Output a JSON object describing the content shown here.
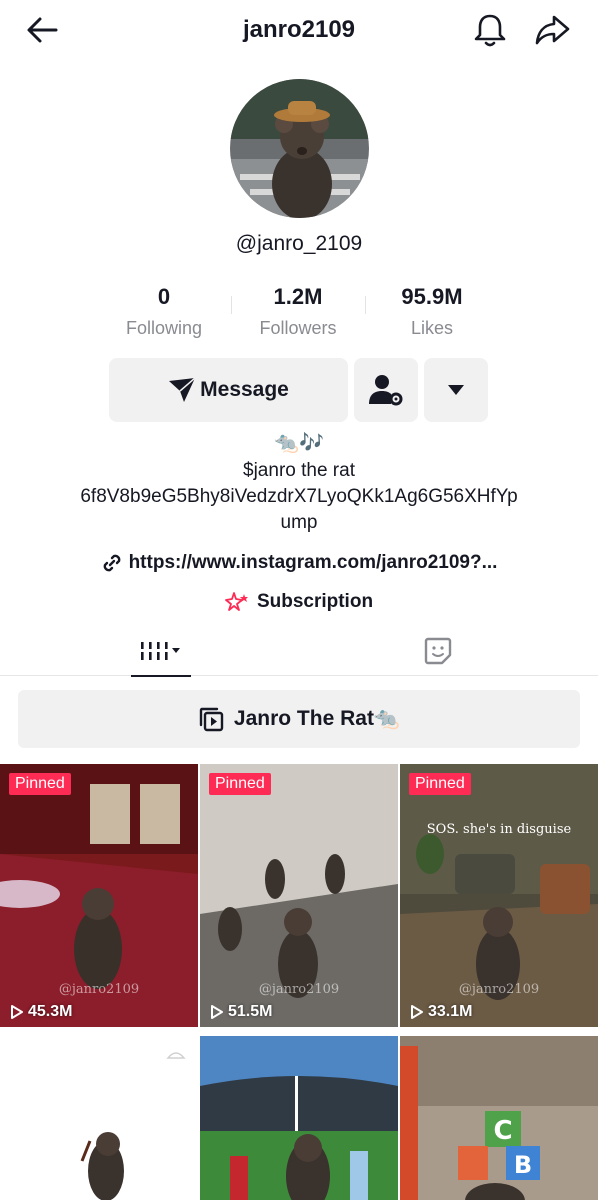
{
  "header": {
    "title": "janro2109",
    "back_icon": "arrow-left-icon",
    "notifications_icon": "bell-icon",
    "share_icon": "share-arrow-icon"
  },
  "profile": {
    "handle": "@janro_2109",
    "avatar_description_icon": "rat-avatar"
  },
  "stats": [
    {
      "value": "0",
      "label": "Following"
    },
    {
      "value": "1.2M",
      "label": "Followers"
    },
    {
      "value": "95.9M",
      "label": "Likes"
    }
  ],
  "actions": {
    "message_label": "Message",
    "message_icon": "paper-plane-icon",
    "add_friend_icon": "user-settings-icon",
    "more_icon": "caret-down-icon"
  },
  "bio": {
    "emoji": "🐀🎶",
    "line1": "$janro the rat",
    "line2": "6f8V8b9eG5Bhy8iVedzdrX7LyoQKk1Ag6G56XHfYp",
    "line3": "ump"
  },
  "link": {
    "icon": "link-icon",
    "text": "https://www.instagram.com/janro2109?..."
  },
  "subscription": {
    "icon": "subscription-stars-icon",
    "label": "Subscription"
  },
  "tabs": {
    "videos_icon": "videos-grid-icon",
    "liked_icon": "liked-sticker-icon"
  },
  "playlist": {
    "icon": "playlist-icon",
    "label": "Janro The Rat🐀"
  },
  "videos": [
    {
      "pinned": "Pinned",
      "views": "45.3M",
      "watermark": "@janro2109"
    },
    {
      "pinned": "Pinned",
      "views": "51.5M",
      "watermark": "@janro2109"
    },
    {
      "pinned": "Pinned",
      "views": "33.1M",
      "watermark": "@janro2109",
      "caption": "SOS. she's in disguise"
    },
    {},
    {},
    {}
  ],
  "colors": {
    "accent": "#fe2c55",
    "text": "#161823",
    "muted": "#8a8b91",
    "button_bg": "#f1f1f2"
  }
}
